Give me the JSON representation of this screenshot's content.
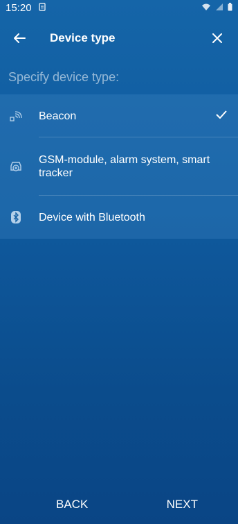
{
  "status_bar": {
    "time": "15:20"
  },
  "app_bar": {
    "title": "Device type"
  },
  "subtitle": "Specify device type:",
  "device_types": [
    {
      "label": "Beacon",
      "icon": "beacon-icon",
      "selected": true
    },
    {
      "label": "GSM-module, alarm system, smart tracker",
      "icon": "car-alarm-icon",
      "selected": false
    },
    {
      "label": "Device with Bluetooth",
      "icon": "bluetooth-icon",
      "selected": false
    }
  ],
  "buttons": {
    "back": "BACK",
    "next": "NEXT"
  }
}
